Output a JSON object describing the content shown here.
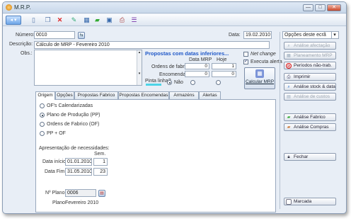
{
  "window": {
    "title": "M.R.P.",
    "min": "—",
    "max": "□",
    "close": "✕"
  },
  "form": {
    "numero_label": "Número:",
    "numero_value": "0010",
    "descricao_label": "Descrição:",
    "descricao_value": "Cálculo de MRP - Fevereiro 2010",
    "obs_label": "Obs.:",
    "data_label": "Data:",
    "data_value": "19.02.2010",
    "options_select": "Opções deste ecrã"
  },
  "proposals": {
    "title": "Propostas com datas inferiores...",
    "col_mrp": "Data MRP",
    "col_hoje": "Hoje",
    "rows": [
      {
        "label": "Ordens de fabrico:",
        "mrp": "0",
        "hoje": "1"
      },
      {
        "label": "Encomendas:",
        "mrp": "0",
        "hoje": "0"
      }
    ],
    "pinta_label": "Pinta linha?",
    "nao_label": "Não"
  },
  "checks": {
    "net_change": "Net change",
    "executa_alerta": "Executa alerta"
  },
  "calc_button": "Calcular MRP",
  "tabs": [
    "Origem",
    "Opções",
    "Propostas Fabrico",
    "Propostas Encomendas",
    "Armazéns",
    "Alertas"
  ],
  "origem": {
    "options": [
      "OF's Calendarizadas",
      "Plano de Produção  (PP)",
      "Ordens de Fabrico  (OF)",
      "PP + OF"
    ],
    "apresentacao_label": "Apresentação de necessidades:",
    "sem_label": "Sem.",
    "data_inicio_label": "Data início:",
    "data_inicio": "01.01.2010",
    "data_inicio_sem": "1",
    "data_fim_label": "Data Fim:",
    "data_fim": "31.05.2010",
    "data_fim_sem": "23",
    "nplano_label": "Nº Plano:",
    "nplano": "0006",
    "plano_label": "Plano:",
    "plano": "Fevereiro 2010"
  },
  "side": {
    "analise_afectacao": "Análise afectação",
    "planeamento_mrp": "Planeamento MRP",
    "periodos": "Períodos não-trab.",
    "imprimir": "Imprimir",
    "analise_stock": "Análise stock & data",
    "analise_custos": "Análise de custos",
    "analise_fabrico": "Análise Fabrico",
    "analise_compras": "Análise Compras",
    "fechar": "Fechar",
    "marcada": "Marcada"
  }
}
